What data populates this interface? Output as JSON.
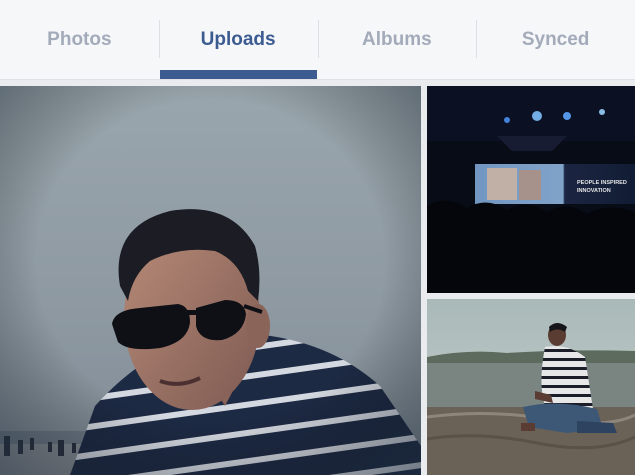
{
  "tabs": [
    {
      "label": "Photos",
      "active": false
    },
    {
      "label": "Uploads",
      "active": true
    },
    {
      "label": "Albums",
      "active": false
    },
    {
      "label": "Synced",
      "active": false
    }
  ],
  "colors": {
    "accent": "#3b5b91",
    "inactive_tab": "#a3abba",
    "tabbar_bg": "#f6f7f9"
  },
  "photos": [
    {
      "subject": "selfie-beach"
    },
    {
      "subject": "stage-presentation",
      "screen_text": [
        "PEOPLE INSPIRED",
        "INNOVATION"
      ]
    },
    {
      "subject": "man-crouching-shore"
    }
  ]
}
